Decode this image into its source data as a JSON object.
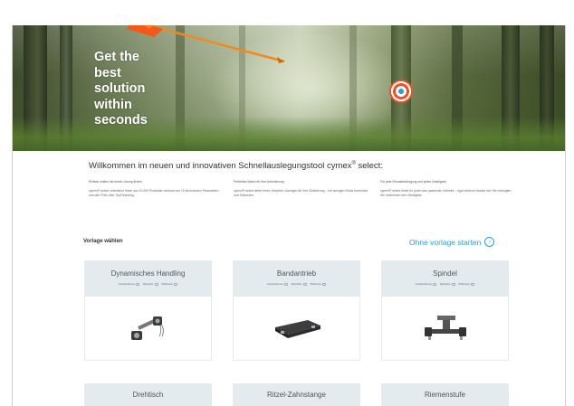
{
  "hero": {
    "title": "Get the\nbest\nsolution\nwithin\nseconds"
  },
  "welcome": {
    "text_prefix": "Willkommen im neuen und innovativen Schnellauslegungstool cymex",
    "registered": "®",
    "text_suffix": " select:"
  },
  "columns": [
    {
      "head": "Einfach wollen die beste Lösung finden",
      "body": "cymex® select unterstützt Ihnen aus 10.000 Produkten anhand von 15 technischen Parametern und den Preis über TopFit/pricing."
    },
    {
      "head": "Perfektes Match für Ihre Anforderung",
      "body": "cymex® select liefert Ihnen Schnelle Lösungen für Ihre Zielsetzung – mit wenigen Klicks berechnet und Sekunden."
    },
    {
      "head": "Für jede Einsatzbedingung und jeden Detailgrad",
      "body": "cymex® select findet für jeden das passende Getriebe – egal welchen Ansatz hier Sie verfolgten. Sie bestimmen den Detailgrad."
    }
  ],
  "vorlage": {
    "label": "Vorlage wählen",
    "start_link": "Ohne vorlage starten",
    "start_icon": "›"
  },
  "filter_labels": [
    "Linearachsen",
    "Dynamic",
    "Präzision"
  ],
  "cards": [
    {
      "title": "Dynamisches Handling",
      "icon": "handling-mechanism-icon"
    },
    {
      "title": "Bandantrieb",
      "icon": "belt-drive-icon"
    },
    {
      "title": "Spindel",
      "icon": "spindle-icon"
    },
    {
      "title": "Drehtisch",
      "icon": "rotary-table-icon"
    },
    {
      "title": "Ritzel-Zahnstange",
      "icon": "rack-pinion-icon"
    },
    {
      "title": "Riemenstufe",
      "icon": "belt-stage-icon"
    }
  ],
  "colors": {
    "accent": "#2a9fd6",
    "card_header": "#e3ebee",
    "arrow": "#f08a1c"
  }
}
